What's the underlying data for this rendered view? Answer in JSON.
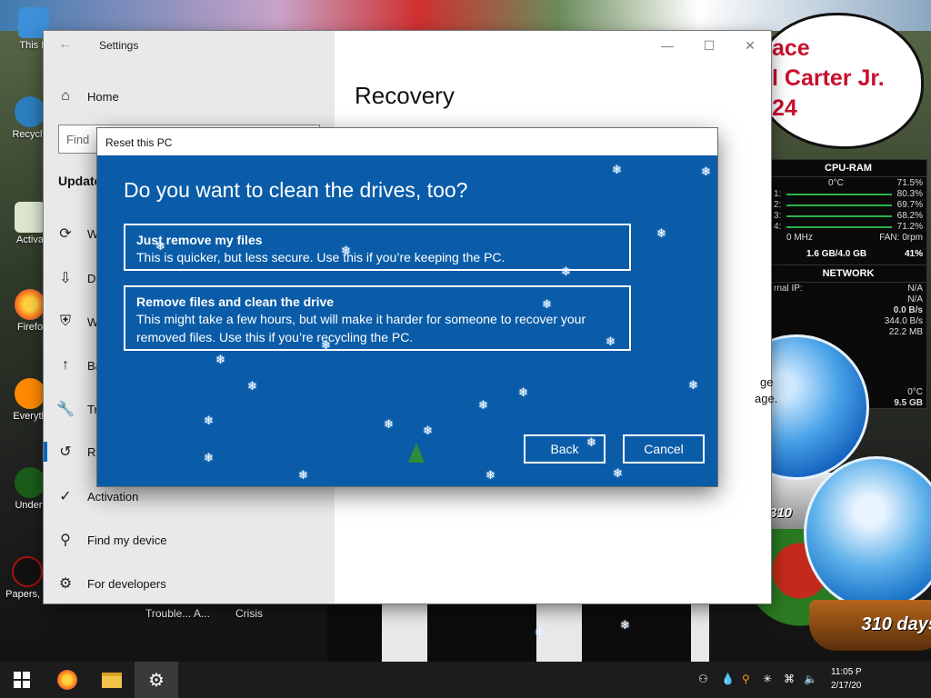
{
  "desktop": {
    "icons": [
      "This P",
      "Recycle",
      "Activa",
      "Firefo",
      "Everyth",
      "Undert",
      "Papers, F"
    ],
    "bubble_lines": [
      "ace",
      "l Carter Jr.",
      "24"
    ],
    "below_labels": [
      "Trouble... A...",
      "Crisis"
    ]
  },
  "gadget": {
    "cpu_title": "CPU-RAM",
    "cpu_temp": "0°C",
    "cpu_total": "71.5%",
    "cores": [
      {
        "id": "1:",
        "value": "80.3%"
      },
      {
        "id": "2:",
        "value": "69.7%"
      },
      {
        "id": "3:",
        "value": "68.2%"
      },
      {
        "id": "4:",
        "value": "71.2%"
      }
    ],
    "freq": "0 MHz",
    "fan": "FAN: 0rpm",
    "ram": "1.6 GB/4.0 GB",
    "ram_pct": "41%",
    "net_title": "NETWORK",
    "net_rows": [
      {
        "label": "rnal IP:",
        "value": "N/A"
      },
      {
        "label": "",
        "value": "N/A"
      },
      {
        "label": "",
        "value": "0.0 B/s"
      },
      {
        "label": "",
        "value": "344.0 B/s"
      },
      {
        "label": "",
        "value": "22.2 MB"
      }
    ],
    "temp2": "0°C",
    "size2": "9.5 GB"
  },
  "globe": {
    "days": "310 days",
    "days_short": "310"
  },
  "settings": {
    "window_title": "Settings",
    "home_label": "Home",
    "find_placeholder": "Find",
    "section_title": "Update",
    "nav_items": [
      {
        "icon": "⟳",
        "label": "W"
      },
      {
        "icon": "⇩",
        "label": "De"
      },
      {
        "icon": "⛨",
        "label": "W"
      },
      {
        "icon": "↑",
        "label": "Ba"
      },
      {
        "icon": "🔧",
        "label": "Tr"
      },
      {
        "icon": "↺",
        "label": "Re"
      },
      {
        "icon": "✓",
        "label": "Activation"
      },
      {
        "icon": "⚲",
        "label": "Find my device"
      },
      {
        "icon": "⚙",
        "label": "For developers"
      }
    ],
    "page_title": "Recovery",
    "right_frag_1": "ge",
    "right_frag_2": "age."
  },
  "dialog": {
    "title": "Reset this PC",
    "heading": "Do you want to clean the drives, too?",
    "options": [
      {
        "title": "Just remove my files",
        "desc": "This is quicker, but less secure. Use this if you’re keeping the PC."
      },
      {
        "title": "Remove files and clean the drive",
        "desc": "This might take a few hours, but will make it harder for someone to recover your removed files. Use this if you’re recycling the PC."
      }
    ],
    "back_label": "Back",
    "cancel_label": "Cancel"
  },
  "taskbar": {
    "time": "11:05 P",
    "date": "2/17/20"
  },
  "colors": {
    "dialog_blue": "#0a5ca8",
    "accent": "#0067c0"
  }
}
